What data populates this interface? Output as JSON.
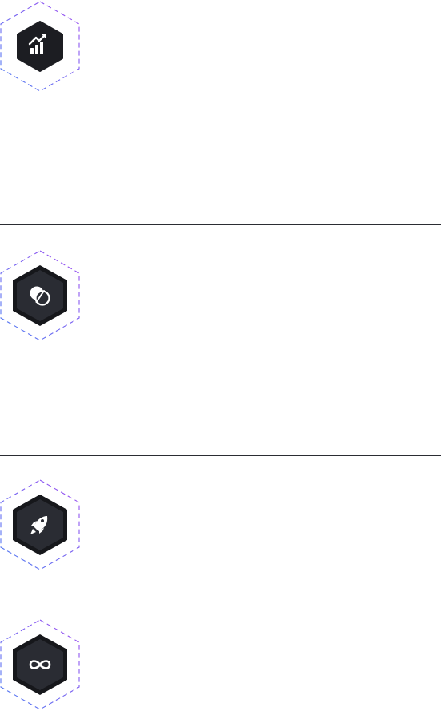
{
  "colors": {
    "background": "#ffffff",
    "divider": "#2b2d33",
    "hex_outer_dark": "#16171b",
    "hex_inner_dark": "#2a2c33",
    "hex_single": "#1c1d22",
    "dash_blue": "#4a7cf2",
    "dash_purple": "#a14cf0",
    "icon_color": "#ffffff"
  },
  "features": [
    {
      "id": "growth",
      "icon": "bar-chart-up-icon"
    },
    {
      "id": "blend",
      "icon": "overlapping-circles-icon"
    },
    {
      "id": "launch",
      "icon": "rocket-icon"
    },
    {
      "id": "infinite",
      "icon": "infinity-icon"
    }
  ]
}
